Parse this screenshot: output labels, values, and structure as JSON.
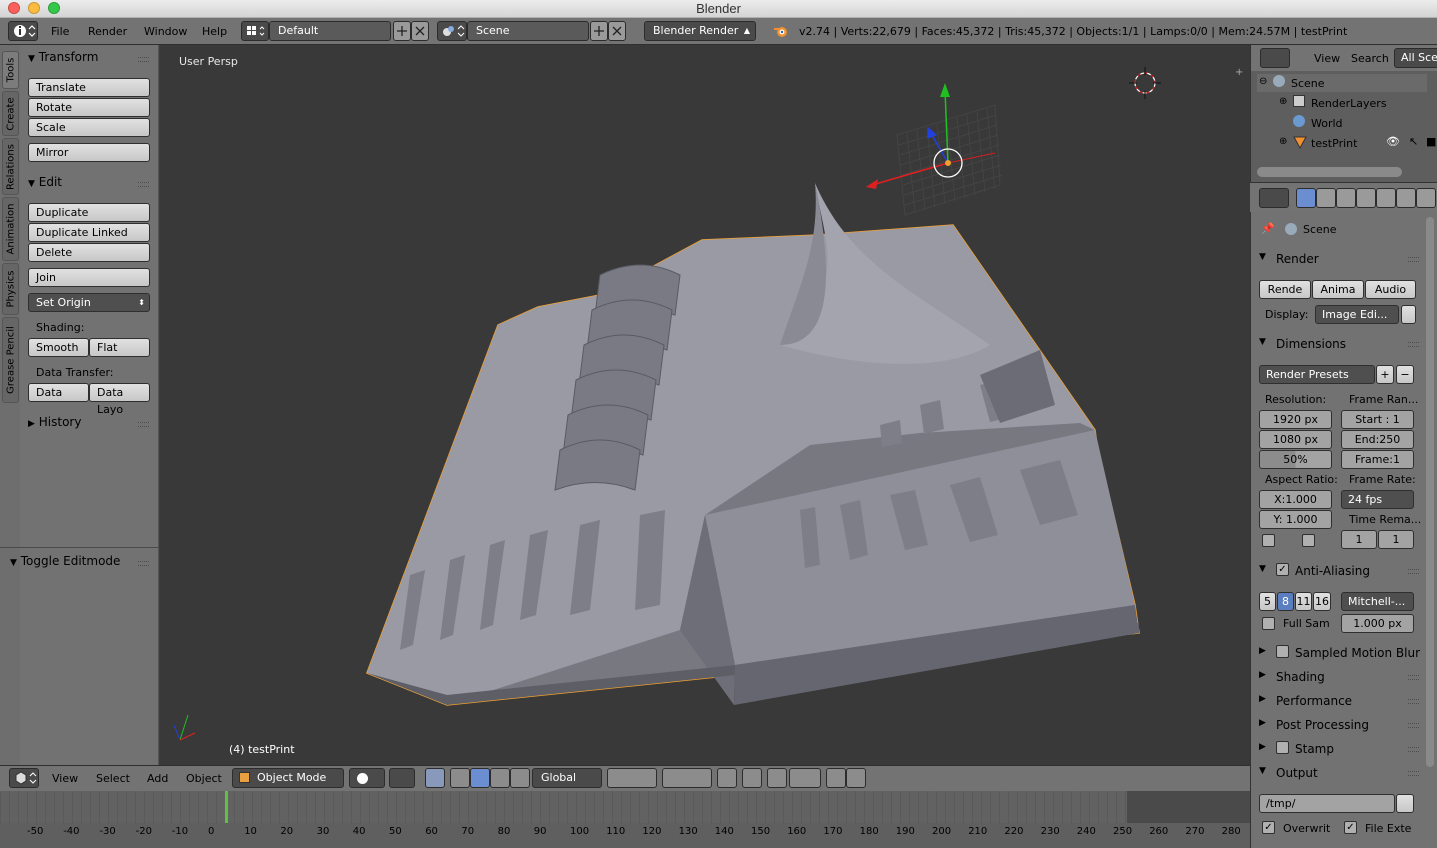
{
  "window": {
    "title": "Blender"
  },
  "menubar": {
    "items": [
      "File",
      "Render",
      "Window",
      "Help"
    ],
    "layout": "Default",
    "scene": "Scene",
    "engine": "Blender Render",
    "stats": "v2.74 | Verts:22,679 | Faces:45,372 | Tris:45,372 | Objects:1/1 | Lamps:0/0 | Mem:24.57M | testPrint"
  },
  "tool_tabs": [
    "Tools",
    "Create",
    "Relations",
    "Animation",
    "Physics",
    "Grease Pencil"
  ],
  "tool_panel": {
    "transform": {
      "title": "Transform",
      "buttons": [
        "Translate",
        "Rotate",
        "Scale",
        "Mirror"
      ]
    },
    "edit": {
      "title": "Edit",
      "buttons": [
        "Duplicate",
        "Duplicate Linked",
        "Delete",
        "Join"
      ],
      "set_origin": "Set Origin",
      "shading_label": "Shading:",
      "shading": [
        "Smooth",
        "Flat"
      ],
      "data_transfer_label": "Data Transfer:",
      "data_transfer": [
        "Data",
        "Data Layo"
      ]
    },
    "history": "History",
    "operator": "Toggle Editmode"
  },
  "viewport": {
    "view_label": "User Persp",
    "object_label": "(4) testPrint"
  },
  "view3d_header": {
    "menus": [
      "View",
      "Select",
      "Add",
      "Object"
    ],
    "mode": "Object Mode",
    "orientation": "Global"
  },
  "timeline": {
    "ticks": [
      "-50",
      "-40",
      "-30",
      "-20",
      "-10",
      "0",
      "10",
      "20",
      "30",
      "40",
      "50",
      "60",
      "70",
      "80",
      "90",
      "100",
      "110",
      "120",
      "130",
      "140",
      "150",
      "160",
      "170",
      "180",
      "190",
      "200",
      "210",
      "220",
      "230",
      "240",
      "250",
      "260",
      "270",
      "280"
    ],
    "current_frame": 4
  },
  "outliner": {
    "menus": [
      "View",
      "Search"
    ],
    "filter": "All Sce",
    "items": [
      "Scene",
      "RenderLayers",
      "World",
      "testPrint"
    ]
  },
  "properties": {
    "context": "Scene",
    "render": {
      "title": "Render",
      "buttons": [
        "Rende",
        "Anima",
        "Audio"
      ],
      "display_label": "Display:",
      "display_value": "Image Edi..."
    },
    "dimensions": {
      "title": "Dimensions",
      "presets": "Render Presets",
      "resolution_label": "Resolution:",
      "frame_range_label": "Frame Ran...",
      "res_x": "1920 px",
      "res_y": "1080 px",
      "res_pct": "50%",
      "start": "Start : 1",
      "end": "End:250",
      "frame": "Frame:1",
      "aspect_label": "Aspect Ratio:",
      "frame_rate_label": "Frame Rate:",
      "aspect_x": "X:1.000",
      "aspect_y": "Y: 1.000",
      "fps": "24 fps",
      "time_remap_label": "Time Rema...",
      "remap_old": "1",
      "remap_new": "1"
    },
    "antialiasing": {
      "title": "Anti-Aliasing",
      "samples": [
        "5",
        "8",
        "11",
        "16"
      ],
      "selected_sample": "8",
      "filter": "Mitchell-...",
      "full_sample": "Full Sam",
      "size": "1.000 px"
    },
    "collapsed_panels": [
      "Sampled Motion Blur",
      "Shading",
      "Performance",
      "Post Processing",
      "Stamp"
    ],
    "output": {
      "title": "Output",
      "path": "/tmp/",
      "overwrite": "Overwrit",
      "file_ext": "File Exte"
    }
  },
  "colors": {
    "selection_outline": "#f0a030",
    "timeline_cursor": "#60c040",
    "x_axis": "#e02020",
    "y_axis": "#20c020",
    "z_axis": "#2040e0"
  }
}
